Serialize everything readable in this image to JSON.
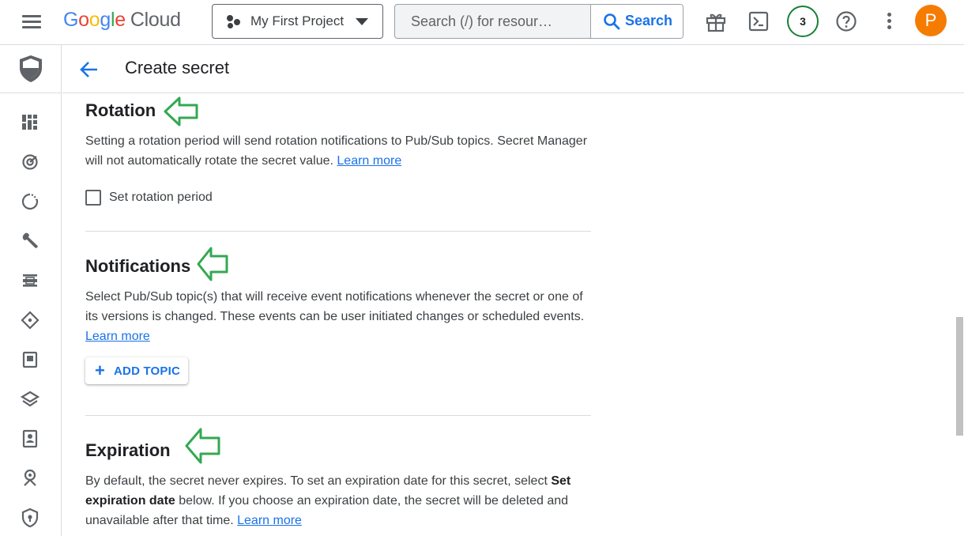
{
  "topbar": {
    "logo": {
      "g": "G",
      "o1": "o",
      "o2": "o",
      "g2": "g",
      "l": "l",
      "e": "e",
      "product": "Cloud"
    },
    "project_name": "My First Project",
    "search_placeholder": "Search (/) for resour…",
    "search_button": "Search",
    "notification_count": "3",
    "avatar_initial": "P"
  },
  "rail": {
    "items": [
      "shield-icon",
      "dashboard-icon",
      "target-icon",
      "refresh-icon",
      "wrench-icon",
      "list-icon",
      "diamond-icon",
      "lock-doc-icon",
      "layers-icon",
      "badge-icon",
      "key-icon",
      "shield-small-icon"
    ]
  },
  "header": {
    "title": "Create secret"
  },
  "rotation": {
    "title": "Rotation",
    "desc": "Setting a rotation period will send rotation notifications to Pub/Sub topics. Secret Manager will not automatically rotate the secret value.",
    "link": "Learn more",
    "checkbox_label": "Set rotation period"
  },
  "notifications": {
    "title": "Notifications",
    "desc": "Select Pub/Sub topic(s) that will receive event notifications whenever the secret or one of its versions is changed. These events can be user initiated changes or scheduled events.",
    "link": "Learn more",
    "button": "ADD TOPIC"
  },
  "expiration": {
    "title": "Expiration",
    "desc_before": "By default, the secret never expires. To set an expiration date for this secret, select",
    "desc_bold": "Set expiration date",
    "desc_after": "below. If you choose an expiration date, the secret will be deleted and unavailable after that time.",
    "link": "Learn more"
  },
  "colors": {
    "accent": "#1a73e8",
    "annotation_arrow": "#34a853",
    "avatar": "#f57c00",
    "badge_ring": "#188038"
  }
}
